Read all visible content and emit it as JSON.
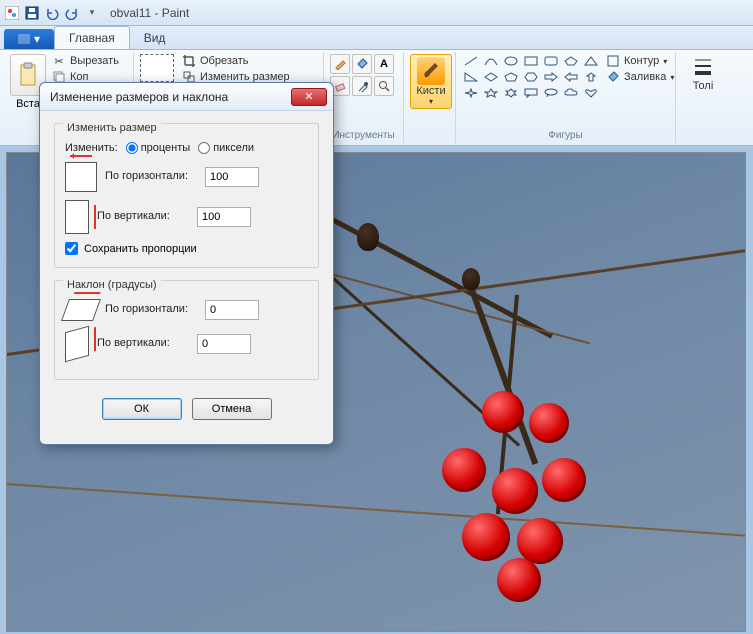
{
  "title": "obval11 - Paint",
  "tabs": {
    "file_dropdown": "▾",
    "main": "Главная",
    "view": "Вид"
  },
  "clipboard": {
    "paste": "Вста",
    "cut": "Вырезать",
    "copy": "Коп"
  },
  "image_group": {
    "crop": "Обрезать",
    "resize": "Изменить размер"
  },
  "tools_label": "Инструменты",
  "brushes": {
    "label": "Кисти"
  },
  "shapes_label": "Фигуры",
  "shape_opts": {
    "outline": "Контур",
    "fill": "Заливка"
  },
  "toli": "Толі",
  "dialog": {
    "title": "Изменение размеров и наклона",
    "resize_legend": "Изменить размер",
    "by_label": "Изменить:",
    "percent": "проценты",
    "pixels": "пиксели",
    "horizontal": "По горизонтали:",
    "vertical": "По вертикали:",
    "h_value": "100",
    "v_value": "100",
    "keep_aspect": "Сохранить пропорции",
    "skew_legend": "Наклон (градусы)",
    "skew_h": "0",
    "skew_v": "0",
    "ok": "ОК",
    "cancel": "Отмена"
  }
}
